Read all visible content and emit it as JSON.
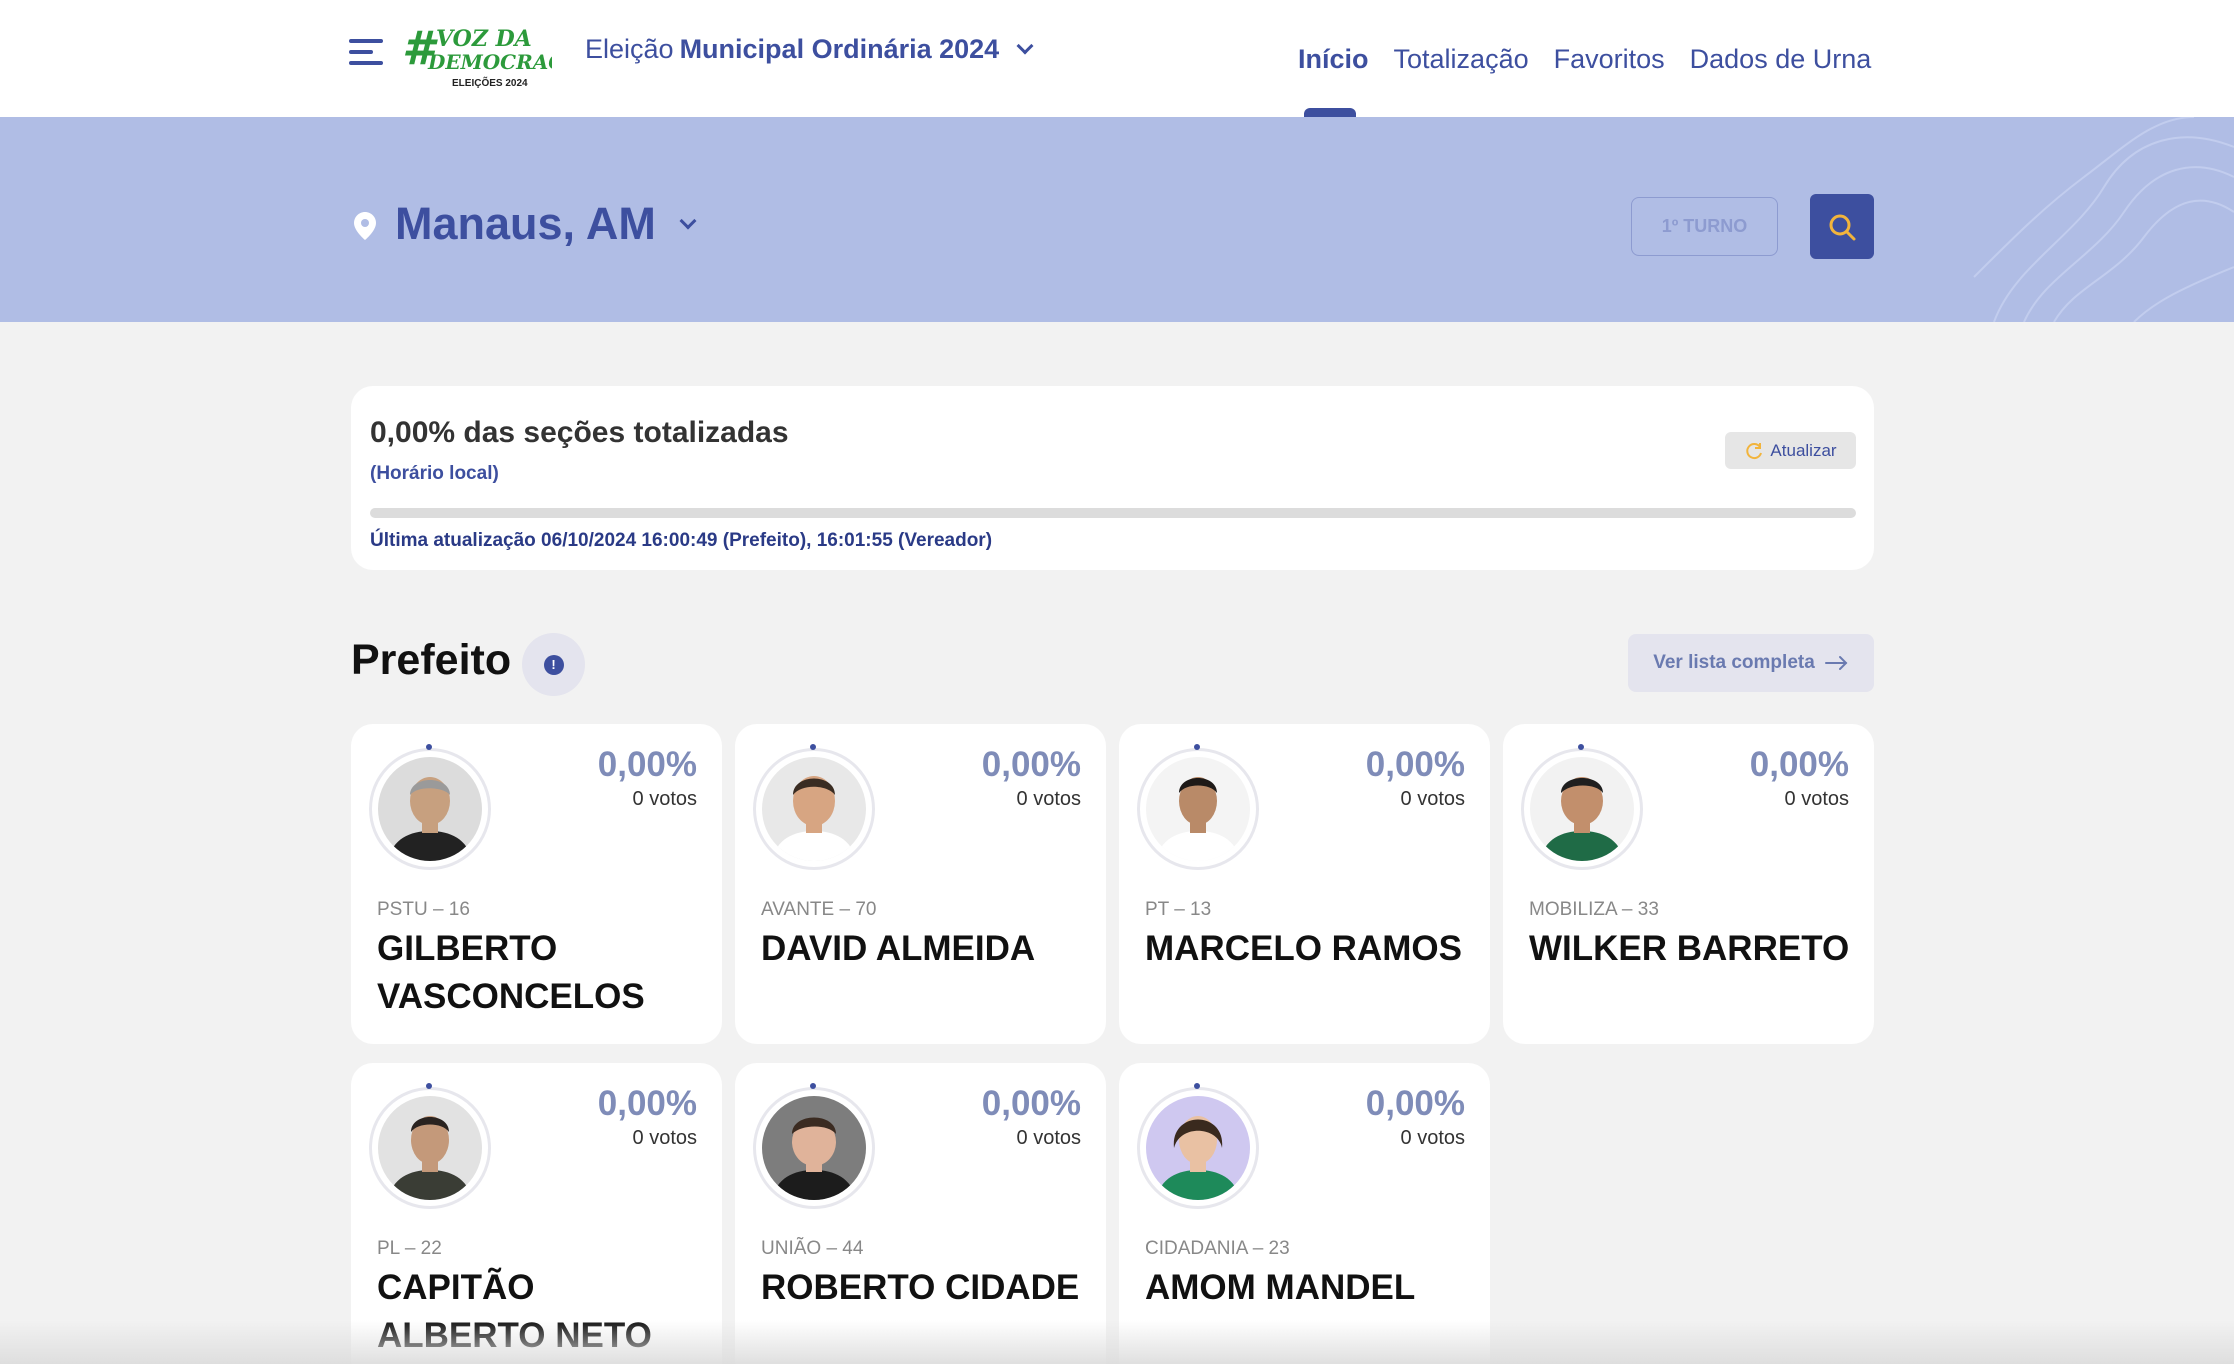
{
  "header": {
    "logo_text": "#VOZ DA DEMOCRACIA",
    "logo_sub": "ELEIÇÕES 2024",
    "election_prefix": "Eleição",
    "election_name": "Municipal Ordinária 2024",
    "nav": [
      "Início",
      "Totalização",
      "Favoritos",
      "Dados de Urna"
    ],
    "active_nav": "Início"
  },
  "location": {
    "city": "Manaus, AM",
    "turno_label": "1º TURNO"
  },
  "progress": {
    "title": "0,00% das seções totalizadas",
    "subtitle": "(Horário local)",
    "refresh_label": "Atualizar",
    "percent": 0,
    "updated": "Última atualização 06/10/2024 16:00:49 (Prefeito), 16:01:55 (Vereador)"
  },
  "section": {
    "title": "Prefeito",
    "info_icon": "!",
    "full_list_label": "Ver lista completa"
  },
  "candidates": [
    {
      "party": "PSTU – 16",
      "name": "GILBERTO VASCONCELOS",
      "pct": "0,00%",
      "votes": "0 votos",
      "skin": "#c7a07f",
      "hair": "#9a9a9a",
      "shirt": "#222222",
      "bg": "#dcdcdc"
    },
    {
      "party": "AVANTE – 70",
      "name": "DAVID ALMEIDA",
      "pct": "0,00%",
      "votes": "0 votos",
      "skin": "#d7a582",
      "hair": "#3a2c22",
      "shirt": "#ffffff",
      "bg": "#e8e8e8"
    },
    {
      "party": "PT – 13",
      "name": "MARCELO RAMOS",
      "pct": "0,00%",
      "votes": "0 votos",
      "skin": "#b98a68",
      "hair": "#1e1a18",
      "shirt": "#ffffff",
      "bg": "#f4f4f4"
    },
    {
      "party": "MOBILIZA – 33",
      "name": "WILKER BARRETO",
      "pct": "0,00%",
      "votes": "0 votos",
      "skin": "#c28f6c",
      "hair": "#1f1f1f",
      "shirt": "#1f6b46",
      "bg": "#f2f2f2"
    },
    {
      "party": "PL – 22",
      "name": "CAPITÃO ALBERTO NETO",
      "pct": "0,00%",
      "votes": "0 votos",
      "skin": "#c4997a",
      "hair": "#2a2320",
      "shirt": "#3a3d35",
      "bg": "#e2e2e2"
    },
    {
      "party": "UNIÃO – 44",
      "name": "ROBERTO CIDADE",
      "pct": "0,00%",
      "votes": "0 votos",
      "skin": "#e0b39a",
      "hair": "#3b2b21",
      "shirt": "#1c1c1c",
      "bg": "#7d7d7d"
    },
    {
      "party": "CIDADANIA – 23",
      "name": "AMOM MANDEL",
      "pct": "0,00%",
      "votes": "0 votos",
      "skin": "#e9c1a3",
      "hair": "#3a2a1e",
      "shirt": "#1e8a5a",
      "bg": "#cfc8f0"
    }
  ],
  "colors": {
    "primary": "#3d4f9f",
    "banner": "#b0bde5",
    "logo_green": "#2c9a3b",
    "search_icon": "#f2b43c"
  },
  "icons": [
    "menu-icon",
    "location-pin-icon",
    "search-icon",
    "refresh-icon",
    "info-icon",
    "arrow-right-icon",
    "chevron-down-icon"
  ]
}
